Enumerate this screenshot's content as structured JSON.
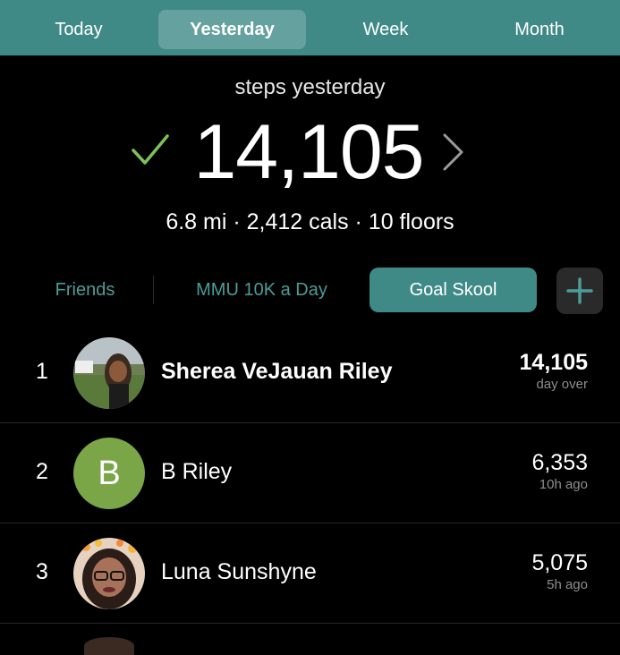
{
  "period_tabs": [
    {
      "label": "Today"
    },
    {
      "label": "Yesterday"
    },
    {
      "label": "Week"
    },
    {
      "label": "Month"
    }
  ],
  "selected_period": "Yesterday",
  "summary": {
    "label": "steps yesterday",
    "total_steps": "14,105",
    "goal_met_icon": "checkmark-icon",
    "detail_icon": "chevron-right-icon",
    "stats": "6.8 mi · 2,412 cals · 10 floors"
  },
  "groups": [
    {
      "label": "Friends"
    },
    {
      "label": "MMU 10K a Day"
    },
    {
      "label": "Goal Skool"
    }
  ],
  "selected_group": "Goal Skool",
  "add_group_icon": "plus-icon",
  "leaderboard": [
    {
      "rank": "1",
      "name": "Sherea VeJauan Riley",
      "steps": "14,105",
      "status": "day over",
      "avatar": "photo"
    },
    {
      "rank": "2",
      "name": "B Riley",
      "steps": "6,353",
      "status": "10h ago",
      "avatar_letter": "B"
    },
    {
      "rank": "3",
      "name": "Luna Sunshyne",
      "steps": "5,075",
      "status": "5h ago",
      "avatar": "photo"
    }
  ],
  "colors": {
    "accent": "#3f8a87",
    "accent_text": "#4c9c98",
    "check": "#7cc25a",
    "letter_avatar": "#7aa647",
    "background": "#000000"
  }
}
